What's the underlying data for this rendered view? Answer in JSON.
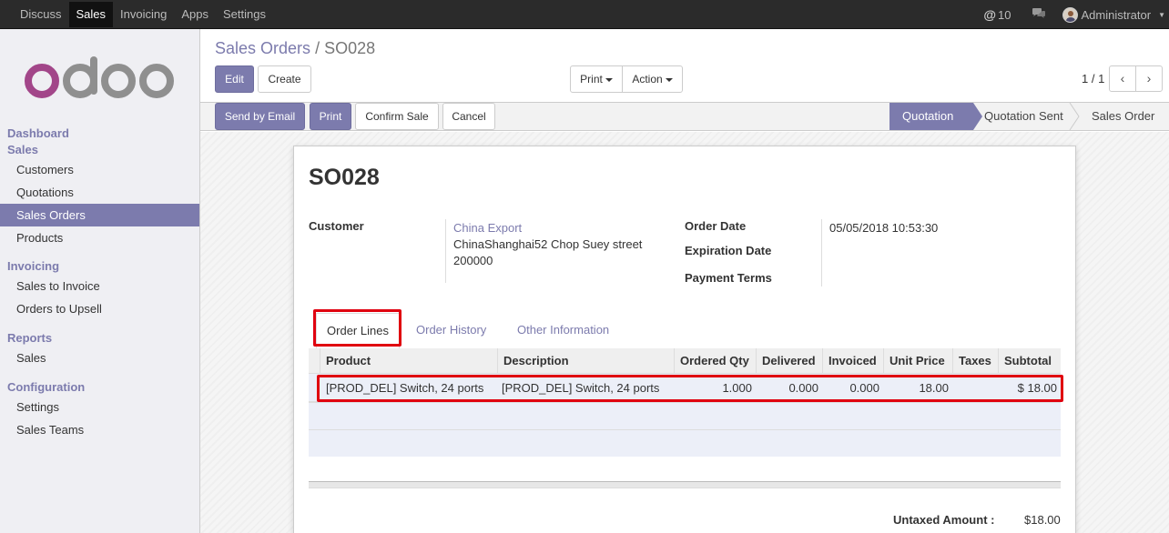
{
  "topbar": {
    "nav": [
      "Discuss",
      "Sales",
      "Invoicing",
      "Apps",
      "Settings"
    ],
    "active": "Sales",
    "mentions_count": "10",
    "user": "Administrator"
  },
  "sidebar": {
    "logo_text": "odoo",
    "sections": [
      {
        "head": "Dashboard",
        "items": []
      },
      {
        "head": "Sales",
        "items": [
          "Customers",
          "Quotations",
          "Sales Orders",
          "Products"
        ]
      },
      {
        "head": "Invoicing",
        "items": [
          "Sales to Invoice",
          "Orders to Upsell"
        ]
      },
      {
        "head": "Reports",
        "items": [
          "Sales"
        ]
      },
      {
        "head": "Configuration",
        "items": [
          "Settings",
          "Sales Teams"
        ]
      }
    ],
    "active_item": "Sales Orders"
  },
  "breadcrumb": {
    "parent": "Sales Orders",
    "separator": "/",
    "current": "SO028"
  },
  "buttons": {
    "edit": "Edit",
    "create": "Create",
    "print": "Print",
    "action": "Action"
  },
  "pager": {
    "text": "1 / 1"
  },
  "status_buttons": {
    "send_email": "Send by Email",
    "print": "Print",
    "confirm": "Confirm Sale",
    "cancel": "Cancel"
  },
  "stages": [
    "Quotation",
    "Quotation Sent",
    "Sales Order"
  ],
  "current_stage": "Quotation",
  "form": {
    "title": "SO028",
    "customer_label": "Customer",
    "customer_name": "China Export",
    "customer_address_1": "ChinaShanghai52 Chop Suey street",
    "customer_address_2": "200000",
    "order_date_label": "Order Date",
    "order_date": "05/05/2018 10:53:30",
    "expiration_label": "Expiration Date",
    "payment_terms_label": "Payment Terms"
  },
  "tabs": [
    "Order Lines",
    "Order History",
    "Other Information"
  ],
  "table": {
    "headers": [
      "Product",
      "Description",
      "Ordered Qty",
      "Delivered",
      "Invoiced",
      "Unit Price",
      "Taxes",
      "Subtotal"
    ],
    "rows": [
      {
        "product": "[PROD_DEL] Switch, 24 ports",
        "description": "[PROD_DEL] Switch, 24 ports",
        "ordered_qty": "1.000",
        "delivered": "0.000",
        "invoiced": "0.000",
        "unit_price": "18.00",
        "taxes": "",
        "subtotal": "$ 18.00"
      }
    ]
  },
  "totals": {
    "untaxed_label": "Untaxed Amount :",
    "untaxed_value": "$18.00"
  },
  "colors": {
    "accent": "#7c7bad",
    "highlight": "#e0000f",
    "topbar": "#2b2b2b"
  }
}
